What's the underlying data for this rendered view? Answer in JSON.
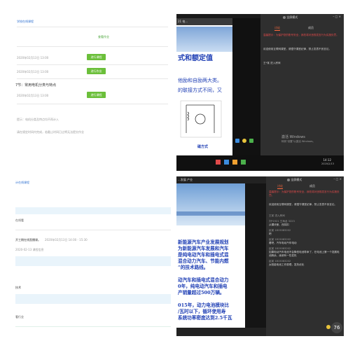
{
  "tl": {
    "header": "学校在线课程",
    "link": "查看作业",
    "items": [
      {
        "date": "2020年02月13日 13:00",
        "button": "进行课程"
      },
      {
        "date": "2020年02月13日 13:00",
        "button": "进行作业"
      }
    ],
    "topic_title": "7节：常用电机分类与特点",
    "topic_date": "2020年02月13日 13:00",
    "topic_button": "进行课程",
    "note1": "提示：电机分类及特点均不再计入",
    "note2": "请在规定时间内完成，若截止时间已过将无法提交作业"
  },
  "tr": {
    "window_title": "21 电...",
    "slide_title": "式和额定值",
    "slide_line1": "他励和自励两大类。",
    "slide_line2": "的联接方式不同，又",
    "slide_caption": "磁方式",
    "top_controls": "全屏模式",
    "tab_active": "讨论",
    "tab_other": "成员",
    "warning": "温馨提示：为保护您的账号安全，我校将对违规发言行为实施处罚。",
    "welcome": "欢迎使用互联网课堂，请遵守课堂纪律，禁止发表不良言论。",
    "join": "王*某 进入房间",
    "activate_title": "激活 Windows",
    "activate_sub": "转到\"设置\"以激活 Windows。",
    "clock_time": "14:12",
    "clock_date": "2020/2/13"
  },
  "bl": {
    "header": "计在线课程",
    "row1": "在线看",
    "row2_a": "开工期在线直播课。",
    "row2_b": "2020年02月13日 14:00 - 15:30",
    "row3": "2020-02-13  课程信息",
    "section": "技术",
    "bottom": "看行业"
  },
  "br": {
    "window_title": "...发展 产业",
    "slide_lines": [
      "新能源汽车产业发展规划",
      "为新能源汽车发展和汽车",
      "是纯电动汽车和插电式混",
      "混合动力汽车、节能内燃",
      "”的技术路线。",
      "",
      "动汽车和插电式混合动力",
      "0年，纯电动汽车和插电",
      "产销量超过500万辆。",
      "",
      "015年，动力电池模块比",
      "/瓦时以下，循环使用寿",
      "系统功率密度达到2.5千瓦"
    ],
    "top_controls": "全屏模式",
    "tab_active": "讨论",
    "tab_other": "成员",
    "warning": "温馨提示：为保护您的账号安全，我校将对违规发言行为实施处罚。",
    "welcome": "欢迎使用互联网课堂，请遵守课堂纪律，禁止发表不良言论。",
    "messages": [
      {
        "name": "王某 进入房间",
        "text": ""
      },
      {
        "name": "刘*1921 王海龙 3223",
        "text": "从模块册、西扣扣"
      },
      {
        "name": "赵某 1815083202",
        "text": "吧"
      },
      {
        "name": "赵某 1815083202",
        "text": "看吧，汽车电动汽车电动"
      },
      {
        "name": "赵某 1815083202",
        "text": "如果电动汽车电池不会降低电池寿命了，在电池上第一个发展电池剩余，续驶有一些发热"
      },
      {
        "name": "赵某 1815083202",
        "text": "太阳能电池工作原理，发热优化"
      }
    ],
    "badge": "76"
  }
}
